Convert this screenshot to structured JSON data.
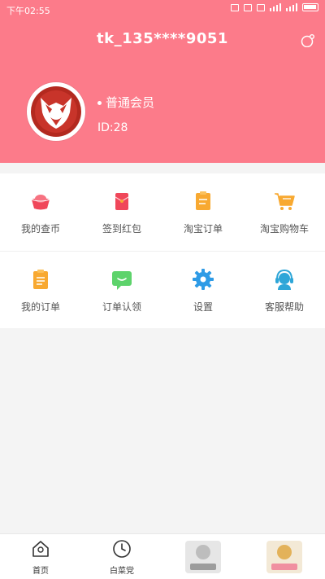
{
  "status_bar": {
    "time": "下午02:55"
  },
  "header": {
    "username": "tk_135****9051",
    "member_level": "普通会员",
    "user_id": "ID:28"
  },
  "menu": {
    "row1": [
      {
        "label": "我的查币",
        "icon": "gold-ingot-icon"
      },
      {
        "label": "签到红包",
        "icon": "red-envelope-icon"
      },
      {
        "label": "淘宝订单",
        "icon": "taobao-order-icon"
      },
      {
        "label": "淘宝购物车",
        "icon": "shopping-cart-icon"
      }
    ],
    "row2": [
      {
        "label": "我的订单",
        "icon": "clipboard-icon"
      },
      {
        "label": "订单认领",
        "icon": "chat-claim-icon"
      },
      {
        "label": "设置",
        "icon": "gear-icon"
      },
      {
        "label": "客服帮助",
        "icon": "customer-service-icon"
      }
    ]
  },
  "tabbar": {
    "home": "首页",
    "baicaidang": "白菜党"
  },
  "colors": {
    "header_bg": "#fc7b8a",
    "accent_red": "#f0475a",
    "accent_orange": "#f8a931",
    "accent_green": "#5dd36b",
    "accent_blue": "#2e9be6"
  }
}
